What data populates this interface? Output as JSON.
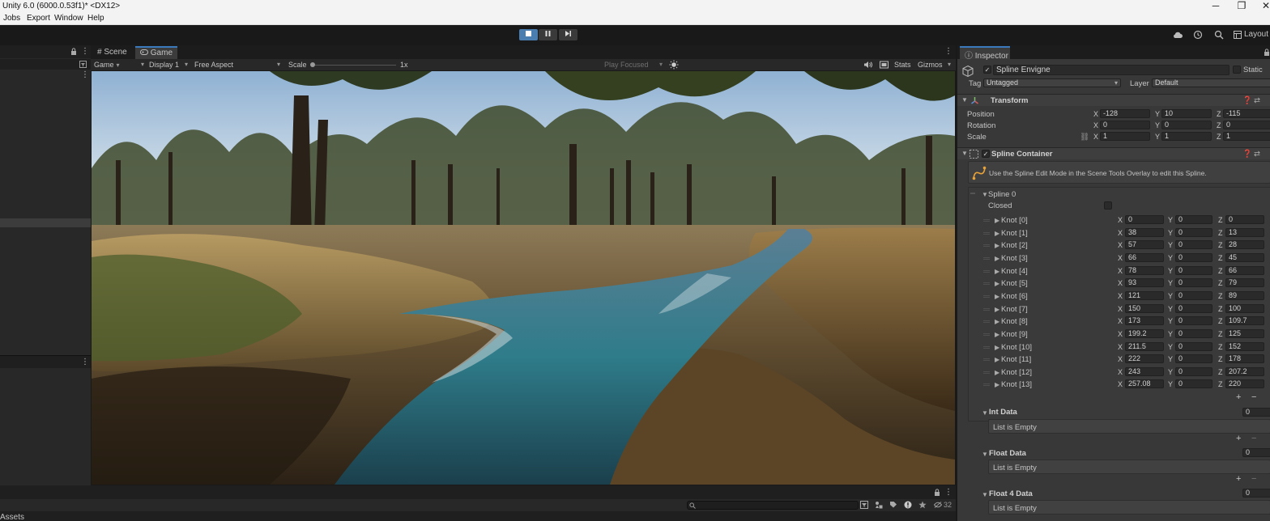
{
  "window": {
    "title": "Unity 6.0 (6000.0.53f1)* <DX12>",
    "controls": [
      "─",
      "❐",
      "✕"
    ]
  },
  "menu": [
    "Jobs",
    "Export",
    "Window",
    "Help"
  ],
  "toolbar": {
    "layout_label": "Layout"
  },
  "left_panel": {
    "scroll_icon": "⋮"
  },
  "view_tabs": [
    {
      "label": "Scene",
      "icon": "hash-icon",
      "active": false
    },
    {
      "label": "Game",
      "icon": "gamepad-icon",
      "active": true
    }
  ],
  "game_bar": {
    "mode": "Game",
    "display": "Display 1",
    "aspect": "Free Aspect",
    "scale_label": "Scale",
    "scale_value": "1x",
    "play_focus": "Play Focused",
    "stats": "Stats",
    "gizmos": "Gizmos"
  },
  "bottom": {
    "assets_label": "Assets",
    "count": "32"
  },
  "inspector": {
    "tab_label": "Inspector",
    "object_name": "Spline Envigne",
    "static_label": "Static",
    "tag_label": "Tag",
    "tag_value": "Untagged",
    "layer_label": "Layer",
    "layer_value": "Default",
    "transform": {
      "title": "Transform",
      "rows": [
        {
          "label": "Position",
          "x": "-128",
          "y": "10",
          "z": "-115"
        },
        {
          "label": "Rotation",
          "x": "0",
          "y": "0",
          "z": "0"
        },
        {
          "label": "Scale",
          "x": "1",
          "y": "1",
          "z": "1"
        }
      ]
    },
    "spline_container": {
      "title": "Spline Container",
      "help_text": "Use the Spline Edit Mode in the Scene Tools Overlay to edit this Spline.",
      "spline_label": "Spline 0",
      "closed_label": "Closed",
      "knots": [
        {
          "label": "Knot [0]",
          "x": "0",
          "y": "0",
          "z": "0"
        },
        {
          "label": "Knot [1]",
          "x": "38",
          "y": "0",
          "z": "13"
        },
        {
          "label": "Knot [2]",
          "x": "57",
          "y": "0",
          "z": "28"
        },
        {
          "label": "Knot [3]",
          "x": "66",
          "y": "0",
          "z": "45"
        },
        {
          "label": "Knot [4]",
          "x": "78",
          "y": "0",
          "z": "66"
        },
        {
          "label": "Knot [5]",
          "x": "93",
          "y": "0",
          "z": "79"
        },
        {
          "label": "Knot [6]",
          "x": "121",
          "y": "0",
          "z": "89"
        },
        {
          "label": "Knot [7]",
          "x": "150",
          "y": "0",
          "z": "100"
        },
        {
          "label": "Knot [8]",
          "x": "173",
          "y": "0",
          "z": "109.7"
        },
        {
          "label": "Knot [9]",
          "x": "199.2",
          "y": "0",
          "z": "125"
        },
        {
          "label": "Knot [10]",
          "x": "211.5",
          "y": "0",
          "z": "152"
        },
        {
          "label": "Knot [11]",
          "x": "222",
          "y": "0",
          "z": "178"
        },
        {
          "label": "Knot [12]",
          "x": "243",
          "y": "0",
          "z": "207.2"
        },
        {
          "label": "Knot [13]",
          "x": "257.08",
          "y": "0",
          "z": "220"
        }
      ],
      "data_sections": [
        {
          "title": "Int Data",
          "count": "0",
          "empty_text": "List is Empty"
        },
        {
          "title": "Float Data",
          "count": "0",
          "empty_text": "List is Empty"
        },
        {
          "title": "Float 4 Data",
          "count": "0",
          "empty_text": "List is Empty"
        }
      ]
    },
    "axes": {
      "x": "X",
      "y": "Y",
      "z": "Z"
    },
    "plus": "+",
    "minus": "−"
  }
}
